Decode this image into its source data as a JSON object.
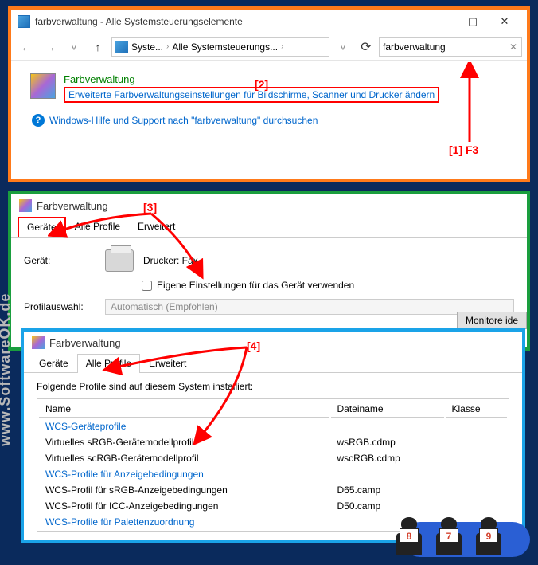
{
  "watermark": "www.SoftwareOK.de",
  "annotations": {
    "a1": "[1] F3",
    "a2": "[2]",
    "a3": "[3]",
    "a4": "[4]"
  },
  "win1": {
    "title": "farbverwaltung - Alle Systemsteuerungselemente",
    "breadcrumb": {
      "p1": "Syste...",
      "p2": "Alle Systemsteuerungs...",
      "sep": "›"
    },
    "search_value": "farbverwaltung",
    "result_title": "Farbverwaltung",
    "result_link": "Erweiterte Farbverwaltungseinstellungen für Bildschirme, Scanner und Drucker ändern",
    "help_link": "Windows-Hilfe und Support nach \"farbverwaltung\" durchsuchen"
  },
  "win2": {
    "title": "Farbverwaltung",
    "tabs": {
      "t1": "Geräte",
      "t2": "Alle Profile",
      "t3": "Erweitert"
    },
    "device_label": "Gerät:",
    "device_name": "Drucker: Fax",
    "checkbox_label": "Eigene Einstellungen für das Gerät verwenden",
    "monitor_btn": "Monitore ide",
    "profile_label": "Profilauswahl:",
    "profile_value": "Automatisch (Empfohlen)"
  },
  "win3": {
    "title": "Farbverwaltung",
    "tabs": {
      "t1": "Geräte",
      "t2": "Alle Profile",
      "t3": "Erweitert"
    },
    "desc": "Folgende Profile sind auf diesem System installiert:",
    "cols": {
      "c1": "Name",
      "c2": "Dateiname",
      "c3": "Klasse"
    },
    "groups": {
      "g1": "WCS-Geräteprofile",
      "g2": "WCS-Profile für Anzeigebedingungen",
      "g3": "WCS-Profile für Palettenzuordnung"
    },
    "rows": [
      {
        "name": "Virtuelles sRGB-Gerätemodellprofil",
        "file": "wsRGB.cdmp",
        "klass": ""
      },
      {
        "name": "Virtuelles scRGB-Gerätemodellprofil",
        "file": "wscRGB.cdmp",
        "klass": ""
      },
      {
        "name": "WCS-Profil für sRGB-Anzeigebedingungen",
        "file": "D65.camp",
        "klass": ""
      },
      {
        "name": "WCS-Profil für ICC-Anzeigebedingungen",
        "file": "D50.camp",
        "klass": ""
      }
    ]
  },
  "mascots": [
    "8",
    "7",
    "9"
  ]
}
